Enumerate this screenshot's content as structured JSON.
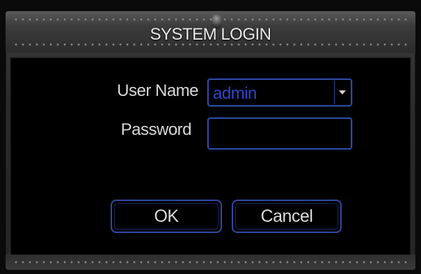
{
  "dialog": {
    "title": "SYSTEM LOGIN"
  },
  "form": {
    "username_label": "User Name",
    "username_value": "admin",
    "password_label": "Password",
    "password_value": ""
  },
  "buttons": {
    "ok_label": "OK",
    "cancel_label": "Cancel"
  },
  "colors": {
    "accent_border": "#2f49a6",
    "value_text": "#2d46c9",
    "label_text": "#d8d8d8"
  },
  "icons": {
    "dropdown": "chevron-down-icon"
  }
}
